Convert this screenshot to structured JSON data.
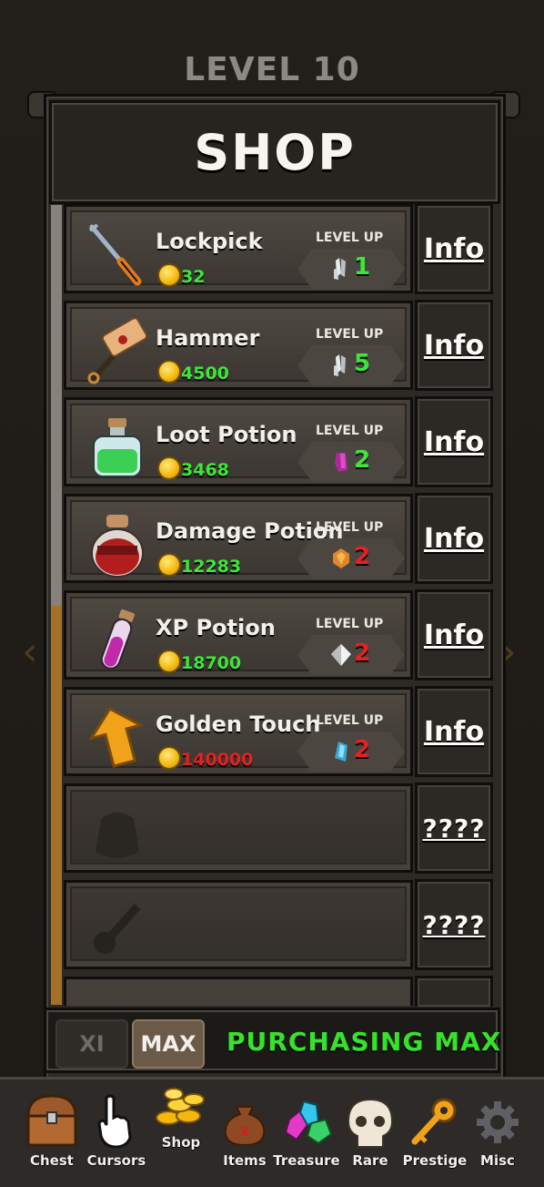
{
  "level_title": "LEVEL 10",
  "shop": {
    "title": "SHOP",
    "level_up_label": "LEVEL UP",
    "items": [
      {
        "name": "Lockpick",
        "price": "32",
        "price_color": "#3ee63a",
        "upgrade_cost": "1",
        "cost_color": "#3ee63a",
        "gem": "white-crystal-icon",
        "icon": "lockpick-icon",
        "info_label": "Info"
      },
      {
        "name": "Hammer",
        "price": "4500",
        "price_color": "#3ee63a",
        "upgrade_cost": "5",
        "cost_color": "#3ee63a",
        "gem": "white-crystal-icon",
        "icon": "hammer-icon",
        "info_label": "Info"
      },
      {
        "name": "Loot Potion",
        "price": "3468",
        "price_color": "#3ee63a",
        "upgrade_cost": "2",
        "cost_color": "#3ee63a",
        "gem": "purple-gem-icon",
        "icon": "green-potion-icon",
        "info_label": "Info"
      },
      {
        "name": "Damage Potion",
        "price": "12283",
        "price_color": "#3ee63a",
        "upgrade_cost": "2",
        "cost_color": "#e52222",
        "gem": "orange-gem-icon",
        "icon": "red-potion-icon",
        "info_label": "Info"
      },
      {
        "name": "XP Potion",
        "price": "18700",
        "price_color": "#3ee63a",
        "upgrade_cost": "2",
        "cost_color": "#e52222",
        "gem": "diamond-icon",
        "icon": "xp-potion-icon",
        "info_label": "Info"
      },
      {
        "name": "Golden Touch",
        "price": "140000",
        "price_color": "#e52222",
        "upgrade_cost": "2",
        "cost_color": "#e52222",
        "gem": "blue-gem-icon",
        "icon": "golden-arrow-icon",
        "info_label": "Info"
      }
    ],
    "locked_items": [
      {
        "icon": "locked-pouch-icon",
        "info_label": "????"
      },
      {
        "icon": "locked-key-icon",
        "info_label": "????"
      }
    ]
  },
  "purchase": {
    "x1_label": "XI",
    "max_label": "MAX",
    "status": "PURCHASING MAX",
    "status_color": "#37e22b"
  },
  "nav": {
    "items": [
      {
        "label": "Chest",
        "icon": "chest-icon"
      },
      {
        "label": "Cursors",
        "icon": "hand-cursor-icon"
      },
      {
        "label": "Shop",
        "icon": "coins-icon"
      },
      {
        "label": "Items",
        "icon": "bag-icon"
      },
      {
        "label": "Treasure",
        "icon": "gems-icon"
      },
      {
        "label": "Rare",
        "icon": "skull-icon"
      },
      {
        "label": "Prestige",
        "icon": "key-icon"
      },
      {
        "label": "Misc",
        "icon": "gear-icon"
      }
    ]
  },
  "colors": {
    "affordable": "#3ee63a",
    "unaffordable": "#e52222",
    "purchasing": "#37e22b"
  }
}
